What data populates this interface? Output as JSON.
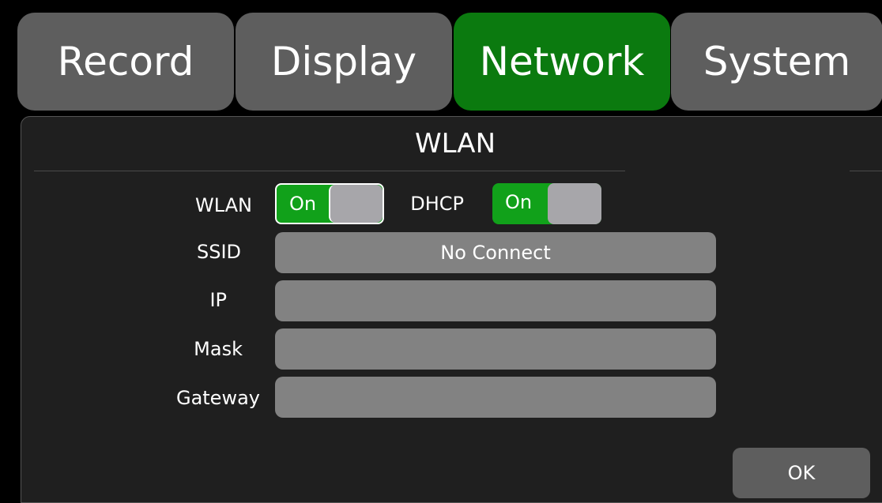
{
  "tabs": [
    {
      "label": "Record",
      "active": false
    },
    {
      "label": "Display",
      "active": false
    },
    {
      "label": "Network",
      "active": true
    },
    {
      "label": "System",
      "active": false
    }
  ],
  "panel": {
    "title": "WLAN"
  },
  "wlan": {
    "label": "WLAN",
    "toggle_text": "On"
  },
  "dhcp": {
    "label": "DHCP",
    "toggle_text": "On"
  },
  "fields": {
    "ssid": {
      "label": "SSID",
      "value": "No Connect"
    },
    "ip": {
      "label": "IP",
      "value": ""
    },
    "mask": {
      "label": "Mask",
      "value": ""
    },
    "gateway": {
      "label": "Gateway",
      "value": ""
    }
  },
  "buttons": {
    "ok_label": "OK"
  },
  "colors": {
    "active_tab": "#0b7a0f",
    "inactive_tab": "#5e5e5e",
    "toggle_on": "#11a11a",
    "field_bg": "#828282",
    "panel_bg": "#1f1f1f"
  }
}
